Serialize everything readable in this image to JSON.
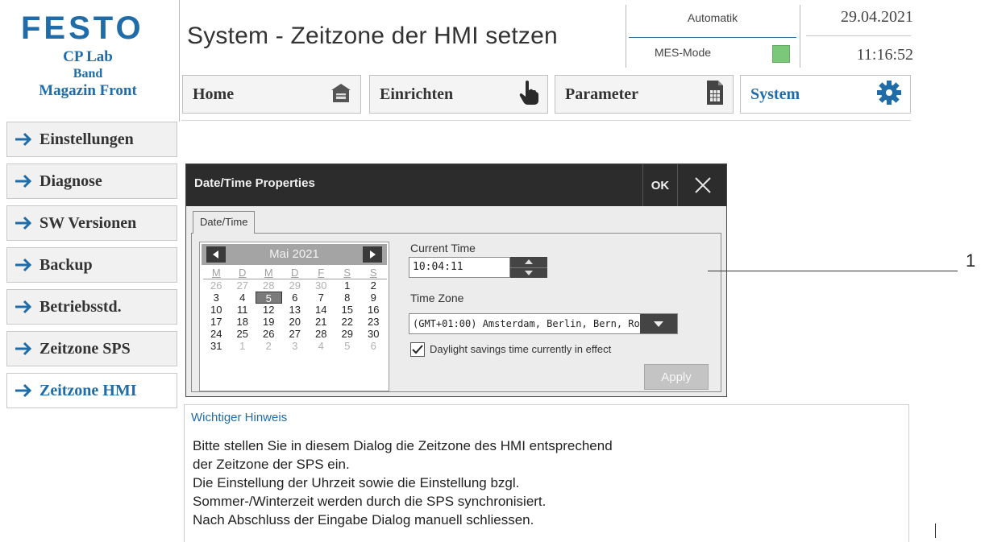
{
  "brand": {
    "logo_text": "FESTO",
    "logo_color": "#1f6ca8"
  },
  "station": {
    "line1": "CP Lab",
    "line2": "Band",
    "line3": "Magazin Front"
  },
  "header": {
    "title": "System - Zeitzone der HMI setzen",
    "mode_label": "Automatik",
    "mes_label": "MES-Mode",
    "mes_status_color": "#7cc87a",
    "date": "29.04.2021",
    "time": "11:16:52"
  },
  "top_nav": [
    {
      "label": "Home",
      "icon": "building-icon"
    },
    {
      "label": "Einrichten",
      "icon": "pointing-hand-icon"
    },
    {
      "label": "Parameter",
      "icon": "document-grid-icon"
    },
    {
      "label": "System",
      "icon": "gear-icon",
      "active": true
    }
  ],
  "side_nav": [
    {
      "label": "Einstellungen"
    },
    {
      "label": "Diagnose"
    },
    {
      "label": "SW Versionen"
    },
    {
      "label": "Backup"
    },
    {
      "label": "Betriebsstd."
    },
    {
      "label": "Zeitzone SPS"
    },
    {
      "label": "Zeitzone HMI",
      "active": true
    }
  ],
  "dialog": {
    "title": "Date/Time Properties",
    "ok_label": "OK",
    "tab_label": "Date/Time",
    "calendar": {
      "month_label": "Mai 2021",
      "weekdays": [
        "M",
        "D",
        "M",
        "D",
        "F",
        "S",
        "S"
      ],
      "weeks": [
        [
          "26",
          "27",
          "28",
          "29",
          "30",
          "1",
          "2"
        ],
        [
          "3",
          "4",
          "5",
          "6",
          "7",
          "8",
          "9"
        ],
        [
          "10",
          "11",
          "12",
          "13",
          "14",
          "15",
          "16"
        ],
        [
          "17",
          "18",
          "19",
          "20",
          "21",
          "22",
          "23"
        ],
        [
          "24",
          "25",
          "26",
          "27",
          "28",
          "29",
          "30"
        ],
        [
          "31",
          "1",
          "2",
          "3",
          "4",
          "5",
          "6"
        ]
      ],
      "selected_day": "5"
    },
    "current_time_label": "Current Time",
    "current_time_value": "10:04:11",
    "time_zone_label": "Time Zone",
    "time_zone_value": "(GMT+01:00) Amsterdam, Berlin, Bern, Ro",
    "dst_checked": true,
    "dst_label": "Daylight savings time currently in effect",
    "apply_label": "Apply"
  },
  "callout_label": "1",
  "notice": {
    "title": "Wichtiger Hinweis",
    "lines": [
      "Bitte stellen Sie in diesem Dialog die Zeitzone des HMI entsprechend",
      "der Zeitzone der SPS ein.",
      "Die Einstellung der Uhrzeit sowie die Einstellung bzgl.",
      "Sommer-/Winterzeit werden durch die SPS synchronisiert.",
      "Nach Abschluss der Eingabe Dialog manuell schliessen."
    ]
  }
}
